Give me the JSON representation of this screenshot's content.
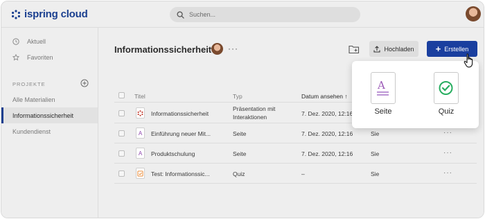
{
  "app": {
    "logo_text": "ispring cloud",
    "brand_color": "#1a3f8f",
    "accent_color": "#1a3f9f"
  },
  "search": {
    "placeholder": "Suchen..."
  },
  "sidebar": {
    "nav": [
      {
        "label": "Aktuell",
        "icon": "clock-icon"
      },
      {
        "label": "Favoriten",
        "icon": "star-icon"
      }
    ],
    "section_label": "PROJEKTE",
    "projects": [
      {
        "label": "Alle Materialien",
        "active": false
      },
      {
        "label": "Informationssicherheit",
        "active": true
      },
      {
        "label": "Kundendienst",
        "active": false
      }
    ]
  },
  "main": {
    "title": "Informationssicherheit",
    "more": "···",
    "upload_label": "Hochladen",
    "create_label": "Erstellen"
  },
  "table": {
    "headers": {
      "title": "Titel",
      "type": "Typ",
      "date": "Datum ansehen ↑"
    },
    "rows": [
      {
        "title": "Informationssicherheit",
        "type_line1": "Präsentation mit",
        "type_line2": "Interaktionen",
        "date": "7. Dez. 2020, 12:16",
        "owner": "",
        "icon": "presentation-icon"
      },
      {
        "title": "Einführung neuer Mit...",
        "type_line1": "Seite",
        "type_line2": "",
        "date": "7. Dez. 2020, 12:16",
        "owner": "Sie",
        "icon": "page-icon"
      },
      {
        "title": "Produktschulung",
        "type_line1": "Seite",
        "type_line2": "",
        "date": "7. Dez. 2020, 12:16",
        "owner": "Sie",
        "icon": "page-icon"
      },
      {
        "title": "Test: Informationssic...",
        "type_line1": "Quiz",
        "type_line2": "",
        "date": "–",
        "owner": "Sie",
        "icon": "quiz-icon"
      }
    ],
    "row_more": "···"
  },
  "dropdown": {
    "items": [
      {
        "label": "Seite",
        "icon": "page-icon"
      },
      {
        "label": "Quiz",
        "icon": "quiz-check-icon"
      }
    ]
  }
}
